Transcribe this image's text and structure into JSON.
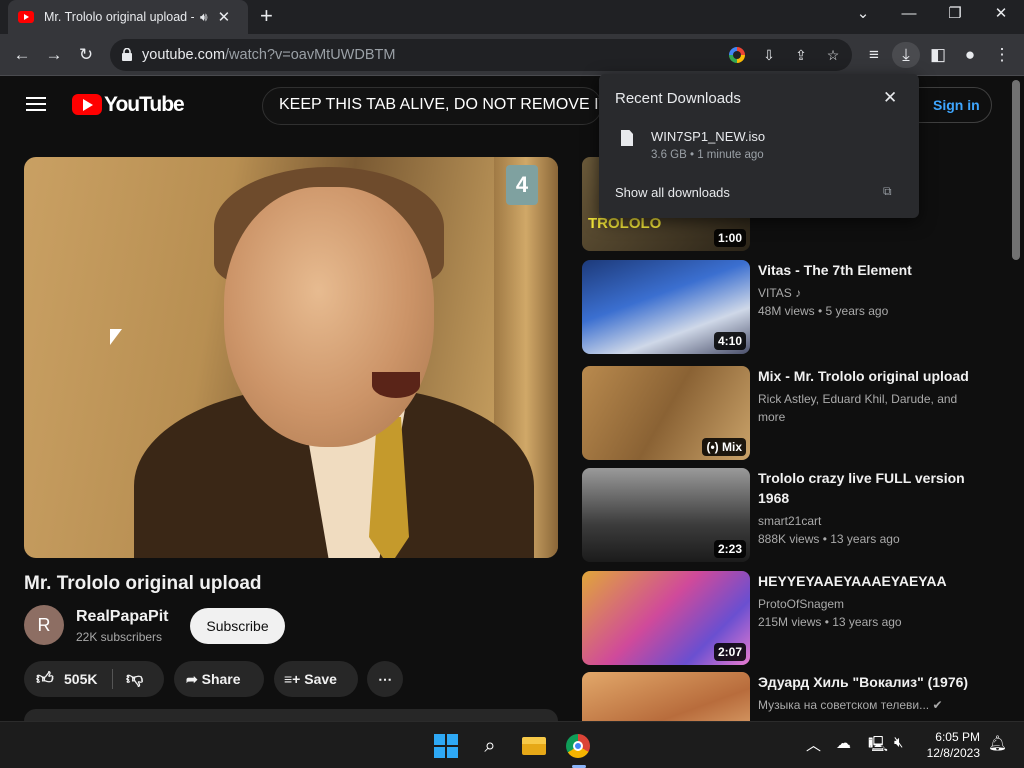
{
  "browser": {
    "tab_title": "Mr. Trololo original upload -",
    "audio_icon": "speaker-icon",
    "url_host": "youtube.com",
    "url_path": "/watch?v=oavMtUWDBTM"
  },
  "youtube": {
    "logo_text": "YouTube",
    "search_text": "KEEP THIS TAB ALIVE,  DO NOT REMOVE IT.",
    "signin_label": "Sign in"
  },
  "video": {
    "channel_badge": "4",
    "title": "Mr. Trololo original upload",
    "channel_initial": "R",
    "channel_name": "RealPapaPit",
    "subscribers": "22K subscribers",
    "subscribe_label": "Subscribe",
    "likes": "505K",
    "share_label": "Share",
    "save_label": "Save",
    "more_label": "⋯"
  },
  "downloads_popup": {
    "header": "Recent Downloads",
    "file_name": "WIN7SP1_NEW.iso",
    "file_meta": "3.6 GB • 1 minute ago",
    "show_all": "Show all downloads"
  },
  "recommendations": [
    {
      "title": "",
      "line1": "",
      "line2": "",
      "duration": "1:00",
      "thumb_text": "TROLOLO"
    },
    {
      "title": "Vitas - The 7th Element",
      "line1": "VITAS ♪",
      "line2": "48M views  • 5 years ago",
      "duration": "4:10"
    },
    {
      "title": "Mix - Mr. Trololo original upload",
      "line1": "Rick Astley, Eduard Khil, Darude, and",
      "line2": "more",
      "duration": "(•) Mix"
    },
    {
      "title": "Trololo crazy live FULL version 1968",
      "line1": "smart21cart",
      "line2": "888K views  • 13 years ago",
      "duration": "2:23"
    },
    {
      "title": "HEYYEYAAEYAAAEYAEYAA",
      "line1": "ProtoOfSnagem",
      "line2": "215M views  • 13 years ago",
      "duration": "2:07"
    },
    {
      "title": "Эдуард Хиль \"Вокализ\" (1976)",
      "line1": "Музыка на советском телеви... ✔",
      "line2": "",
      "duration": ""
    }
  ],
  "taskbar": {
    "time": "6:05 PM",
    "date": "12/8/2023"
  }
}
